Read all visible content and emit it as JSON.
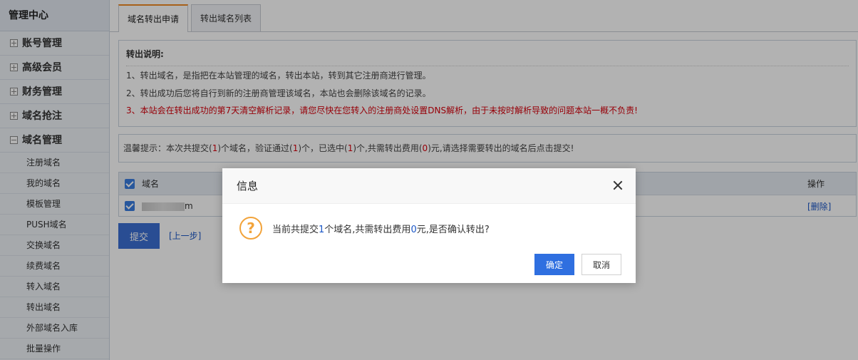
{
  "sidebar": {
    "title": "管理中心",
    "groups": [
      {
        "label": "账号管理",
        "expanded": false
      },
      {
        "label": "高级会员",
        "expanded": false
      },
      {
        "label": "财务管理",
        "expanded": false
      },
      {
        "label": "域名抢注",
        "expanded": false
      },
      {
        "label": "域名管理",
        "expanded": true
      }
    ],
    "sub_items": [
      "注册域名",
      "我的域名",
      "模板管理",
      "PUSH域名",
      "交换域名",
      "续费域名",
      "转入域名",
      "转出域名",
      "外部域名入库",
      "批量操作"
    ]
  },
  "tabs": [
    "域名转出申请",
    "转出域名列表"
  ],
  "notice": {
    "title": "转出说明:",
    "line1": "1、转出域名，是指把在本站管理的域名，转出本站，转到其它注册商进行管理。",
    "line2": "2、转出成功后您将自行到新的注册商管理该域名，本站也会删除该域名的记录。",
    "line3": "3、本站会在转出成功的第7天清空解析记录，请您尽快在您转入的注册商处设置DNS解析，由于未按时解析导致的问题本站一概不负责!"
  },
  "tip": {
    "p1": "温馨提示：本次共提交(",
    "n1": "1",
    "p2": ")个域名，验证通过(",
    "n2": "1",
    "p3": ")个，已选中(",
    "n3": "1",
    "p4": ")个,共需转出费用(",
    "n4": "0",
    "p5": ")元,请选择需要转出的域名后点击提交!"
  },
  "table": {
    "col_name": "域名",
    "col_op": "操作",
    "row_domain_suffix": "m",
    "row_op": "[删除]"
  },
  "actions": {
    "submit": "提交",
    "prev": "[上一步]"
  },
  "dialog": {
    "title": "信息",
    "msg_p1": "当前共提交",
    "msg_n1": "1",
    "msg_p2": "个域名,共需转出费用",
    "msg_n2": "0",
    "msg_p3": "元,是否确认转出?",
    "ok": "确定",
    "cancel": "取消"
  },
  "colors": {
    "accent": "#2f6fe0",
    "warning": "#d8000c",
    "question": "#f2a33a"
  }
}
